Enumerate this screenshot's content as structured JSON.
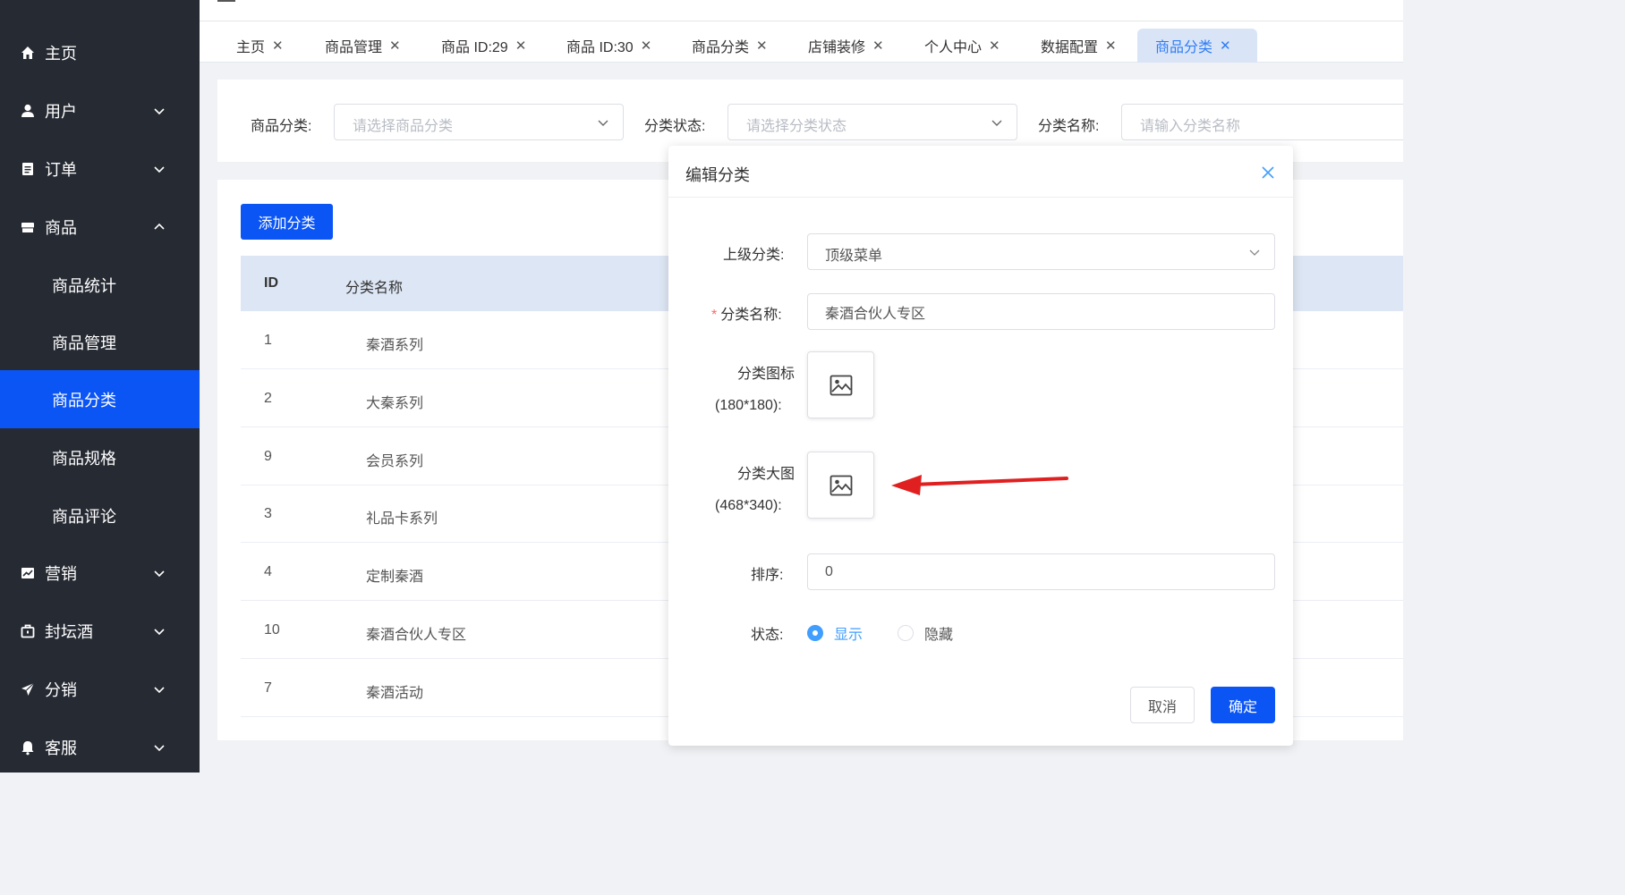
{
  "sidebar": {
    "items": [
      {
        "label": "主页",
        "icon": "home-icon"
      },
      {
        "label": "用户",
        "icon": "user-icon"
      },
      {
        "label": "订单",
        "icon": "order-icon"
      },
      {
        "label": "商品",
        "icon": "shop-icon"
      },
      {
        "label": "商品统计"
      },
      {
        "label": "商品管理"
      },
      {
        "label": "商品分类"
      },
      {
        "label": "商品规格"
      },
      {
        "label": "商品评论"
      },
      {
        "label": "营销",
        "icon": "chart-icon"
      },
      {
        "label": "封坛酒",
        "icon": "briefcase-icon"
      },
      {
        "label": "分销",
        "icon": "send-icon"
      },
      {
        "label": "客服",
        "icon": "bell-icon"
      }
    ],
    "active_color": "#0b55f5",
    "bg_color": "#262a33"
  },
  "tabs": [
    {
      "label": "主页"
    },
    {
      "label": "商品管理"
    },
    {
      "label": "商品 ID:29"
    },
    {
      "label": "商品 ID:30"
    },
    {
      "label": "商品分类"
    },
    {
      "label": "店铺装修"
    },
    {
      "label": "个人中心"
    },
    {
      "label": "数据配置"
    },
    {
      "label": "商品分类"
    }
  ],
  "filter": {
    "category_label": "商品分类:",
    "category_placeholder": "请选择商品分类",
    "status_label": "分类状态:",
    "status_placeholder": "请选择分类状态",
    "name_label": "分类名称:",
    "name_placeholder": "请输入分类名称"
  },
  "table": {
    "add_button": "添加分类",
    "headers": {
      "id": "ID",
      "name": "分类名称"
    },
    "rows": [
      {
        "id": "1",
        "name": "秦酒系列"
      },
      {
        "id": "2",
        "name": "大秦系列"
      },
      {
        "id": "9",
        "name": "会员系列"
      },
      {
        "id": "3",
        "name": "礼品卡系列"
      },
      {
        "id": "4",
        "name": "定制秦酒"
      },
      {
        "id": "10",
        "name": "秦酒合伙人专区"
      },
      {
        "id": "7",
        "name": "秦酒活动"
      }
    ]
  },
  "dialog": {
    "title": "编辑分类",
    "parent_label": "上级分类:",
    "parent_value": "顶级菜单",
    "name_label": "分类名称:",
    "name_value": "秦酒合伙人专区",
    "icon_label_line1": "分类图标",
    "icon_label_line2": "(180*180):",
    "big_label_line1": "分类大图",
    "big_label_line2": "(468*340):",
    "sort_label": "排序:",
    "sort_value": "0",
    "status_label": "状态:",
    "status_show": "显示",
    "status_hide": "隐藏",
    "cancel": "取消",
    "confirm": "确定"
  },
  "colors": {
    "primary": "#0b55f5",
    "link_blue": "#409eff",
    "annotation_red": "#e02020"
  }
}
